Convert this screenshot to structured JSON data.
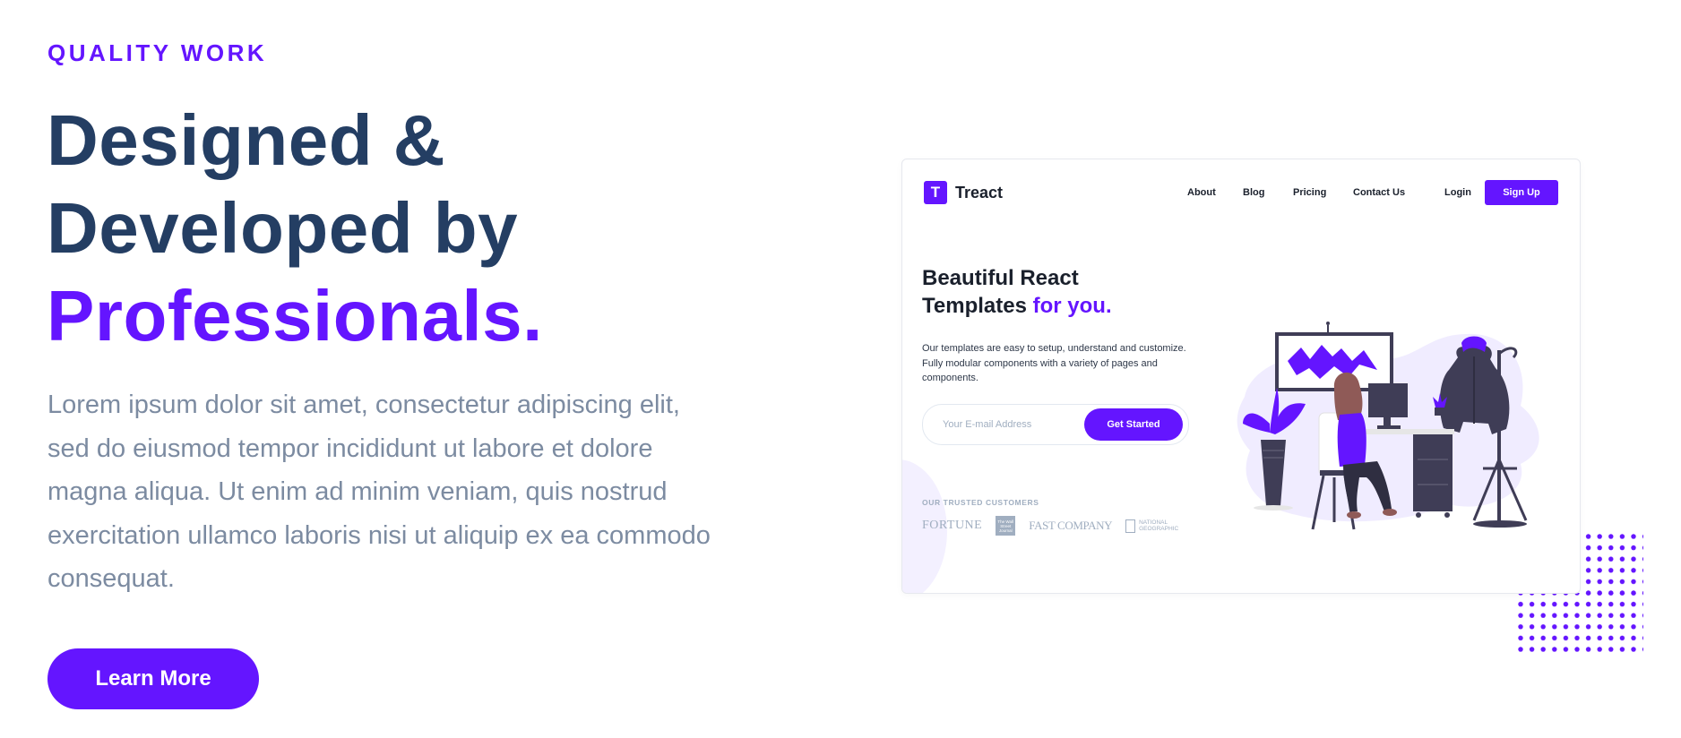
{
  "hero": {
    "subheading": "QUALITY WORK",
    "heading_line1": "Designed &",
    "heading_line2": "Developed by",
    "heading_highlight": "Professionals.",
    "description": "Lorem ipsum dolor sit amet, consectetur adipiscing elit, sed do eiusmod tempor incididunt ut labore et dolore magna aliqua. Ut enim ad minim veniam, quis nostrud exercitation ullamco laboris nisi ut aliquip ex ea commodo consequat.",
    "cta_label": "Learn More"
  },
  "preview": {
    "logo_letter": "T",
    "logo_text": "Treact",
    "nav": [
      "About",
      "Blog",
      "Pricing",
      "Contact Us"
    ],
    "login": "Login",
    "signup": "Sign Up",
    "title_line1": "Beautiful React",
    "title_line2": "Templates",
    "title_highlight": "for you.",
    "description": "Our templates are easy to setup, understand and customize. Fully modular components with a variety of pages and components.",
    "email_placeholder": "Your E-mail Address",
    "cta": "Get Started",
    "trusted_label": "OUR TRUSTED CUSTOMERS",
    "customers": {
      "fortune": "FORTUNE",
      "wsj": "The Wall Street Journal",
      "fastcompany": "FAST COMPANY",
      "natgeo": "NATIONAL GEOGRAPHIC"
    }
  },
  "colors": {
    "accent": "#6415ff",
    "heading": "#243e63",
    "body": "#7c8ba1"
  },
  "icons": [
    "dots-pattern-icon",
    "treact-logo-icon",
    "person-at-desk-illustration"
  ]
}
